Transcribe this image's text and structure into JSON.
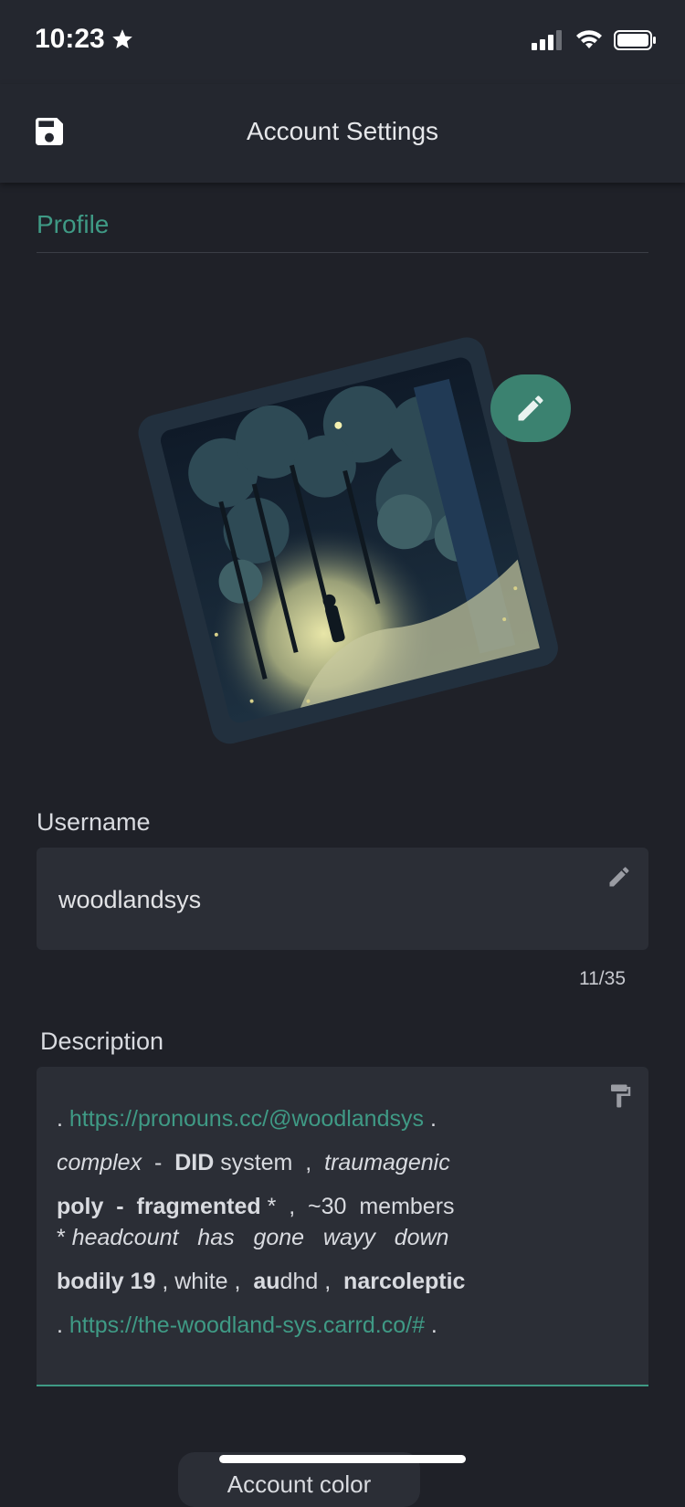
{
  "status_bar": {
    "time": "10:23"
  },
  "app_bar": {
    "title": "Account Settings",
    "save_icon": "floppy-disk-icon"
  },
  "profile": {
    "section_title": "Profile",
    "avatar_description_icon": "avatar-image",
    "edit_icon": "pencil-icon"
  },
  "username": {
    "label": "Username",
    "value": "woodlandsys",
    "count": "11/35"
  },
  "description": {
    "label": "Description",
    "lines": [
      [
        {
          "t": ". ",
          "s": ""
        },
        {
          "t": "https://pronouns.cc/@woodlandsys",
          "s": "link"
        },
        {
          "t": " .",
          "s": ""
        }
      ],
      [
        {
          "t": "complex",
          "s": "i"
        },
        {
          "t": "  -  ",
          "s": ""
        },
        {
          "t": "DID",
          "s": "b"
        },
        {
          "t": " system  ,  ",
          "s": ""
        },
        {
          "t": "traumagenic",
          "s": "i"
        }
      ],
      [
        {
          "t": "poly  -  fragmented",
          "s": "b"
        },
        {
          "t": " *  ,  ~30  members",
          "s": ""
        }
      ],
      [
        {
          "t": "* ",
          "s": ""
        },
        {
          "t": "headcount   has   gone   wayy   down",
          "s": "i"
        }
      ],
      [
        {
          "t": "bodily 19",
          "s": "b"
        },
        {
          "t": " , white ,  ",
          "s": ""
        },
        {
          "t": "au",
          "s": "b"
        },
        {
          "t": "dhd ,  ",
          "s": ""
        },
        {
          "t": "narcoleptic",
          "s": "b"
        }
      ],
      [
        {
          "t": ". ",
          "s": ""
        },
        {
          "t": "https://the-woodland-sys.carrd.co/#",
          "s": "link"
        },
        {
          "t": " .",
          "s": ""
        }
      ]
    ]
  },
  "bottom_partial_button": "Account color"
}
